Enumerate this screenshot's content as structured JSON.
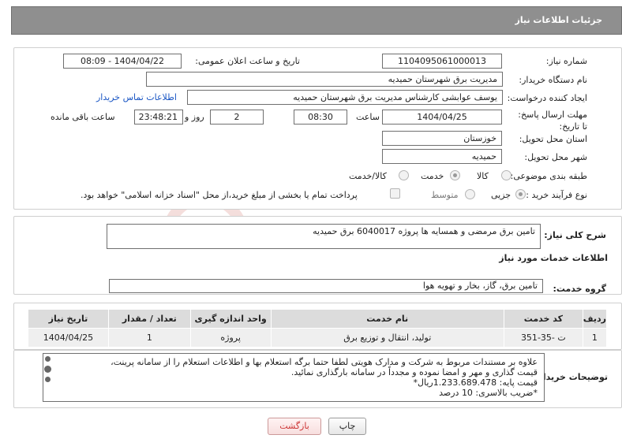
{
  "header": {
    "title": "جزئیات اطلاعات نیاز"
  },
  "form": {
    "need_number": {
      "label": "شماره نیاز:",
      "value": "1104095061000013"
    },
    "announce_datetime": {
      "label": "تاریخ و ساعت اعلان عمومی:",
      "value": "1404/04/22 - 08:09"
    },
    "buyer_org": {
      "label": "نام دستگاه خریدار:",
      "value": "مدیریت برق شهرستان حمیدیه"
    },
    "requester": {
      "label": "ایجاد کننده درخواست:",
      "value": "یوسف عوابشی کارشناس مدیریت برق شهرستان حمیدیه",
      "contact_link": "اطلاعات تماس خریدار"
    },
    "deadline": {
      "label": "مهلت ارسال پاسخ: تا تاریخ:",
      "date": "1404/04/25",
      "time_label": "ساعت",
      "time": "08:30",
      "days": "2",
      "days_label": "روز و",
      "remaining": "23:48:21",
      "remaining_label": "ساعت باقی مانده"
    },
    "province": {
      "label": "استان محل تحویل:",
      "value": "خوزستان"
    },
    "city": {
      "label": "شهر محل تحویل:",
      "value": "حمیدیه"
    },
    "category": {
      "label": "طبقه بندی موضوعی:",
      "options": [
        "کالا",
        "خدمت",
        "کالا/خدمت"
      ],
      "selected": "خدمت"
    },
    "purchase_type": {
      "label": "نوع فرآیند خرید :",
      "options": [
        "جزیی",
        "متوسط"
      ],
      "selected": "جزیی",
      "treasury_note": "پرداخت تمام یا بخشی از مبلغ خرید،از محل \"اسناد خزانه اسلامی\" خواهد بود."
    }
  },
  "summary": {
    "label": "شرح کلی نیاز:",
    "value": "تامین برق مرمضی و همسایه ها پروژه 6040017 برق حمیدیه"
  },
  "services_section": {
    "title": "اطلاعات خدمات مورد نیاز",
    "group_label": "گروه خدمت:",
    "group_value": "تامین برق، گاز، بخار و تهویه هوا"
  },
  "table": {
    "headers": [
      "ردیف",
      "کد خدمت",
      "نام خدمت",
      "واحد اندازه گیری",
      "تعداد / مقدار",
      "تاریخ نیاز"
    ],
    "rows": [
      [
        "1",
        "ت -35-351",
        "تولید، انتقال و توزیع برق",
        "پروژه",
        "1",
        "1404/04/25"
      ]
    ]
  },
  "buyer_notes": {
    "label": "توضیحات خریدار:",
    "lines": [
      "علاوه بر مستندات مربوط به شرکت و مدارک هویتی لطفا حتما برگه استعلام بها و اطلاعات استعلام را از سامانه پرینت،",
      "قیمت گذاری و مهر و امضا نموده و مجدداً در سامانه بارگذاری نمائید.",
      "قیمت پایه: 1.233.689.478ریال*",
      "*ضریب بالاسری:  10 درصد"
    ]
  },
  "buttons": {
    "print": "چاپ",
    "back": "بازگشت"
  },
  "watermark": {
    "text": "AriaTender.neT",
    "color": "#c0392b"
  }
}
